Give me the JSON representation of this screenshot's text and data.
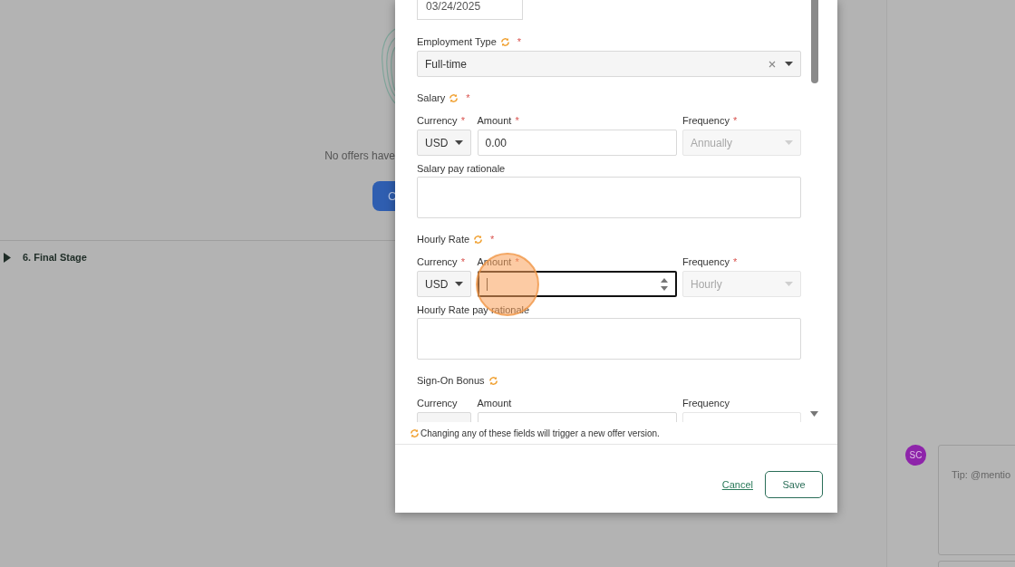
{
  "required_mark": "*",
  "background": {
    "empty_message": "No offers have",
    "button_label": "C",
    "stage": {
      "label": "6. Final Stage",
      "expanded": false
    }
  },
  "comment": {
    "avatar": "SC",
    "color": "#8e24aa",
    "placeholder": "Tip: @mentio"
  },
  "modal": {
    "date_value": "03/24/2025",
    "employment_type": {
      "label": "Employment Type",
      "versioned": true,
      "required": true,
      "value": "Full-time"
    },
    "sections": [
      {
        "title": "Salary",
        "versioned": true,
        "required": true,
        "currency": {
          "label": "Currency",
          "required": true,
          "value": "USD"
        },
        "amount": {
          "label": "Amount",
          "required": true,
          "value": "0.00",
          "focused": false
        },
        "frequency": {
          "label": "Frequency",
          "required": true,
          "value": "Annually",
          "disabled": true
        },
        "rationale": {
          "label": "Salary pay rationale"
        }
      },
      {
        "title": "Hourly Rate",
        "versioned": true,
        "required": true,
        "currency": {
          "label": "Currency",
          "required": true,
          "value": "USD"
        },
        "amount": {
          "label": "Amount",
          "required": true,
          "focused": true
        },
        "frequency": {
          "label": "Frequency",
          "required": true,
          "value": "Hourly",
          "disabled": true
        },
        "rationale": {
          "label": "Hourly Rate pay rationale"
        }
      },
      {
        "title": "Sign-On Bonus",
        "versioned": true,
        "required": false,
        "currency": {
          "label": "Currency",
          "required": false
        },
        "amount": {
          "label": "Amount",
          "required": false,
          "focused": false
        },
        "frequency": {
          "label": "Frequency",
          "required": false
        }
      }
    ],
    "note": "Changing any of these fields will trigger a new offer version.",
    "cancel": "Cancel",
    "save": "Save"
  }
}
